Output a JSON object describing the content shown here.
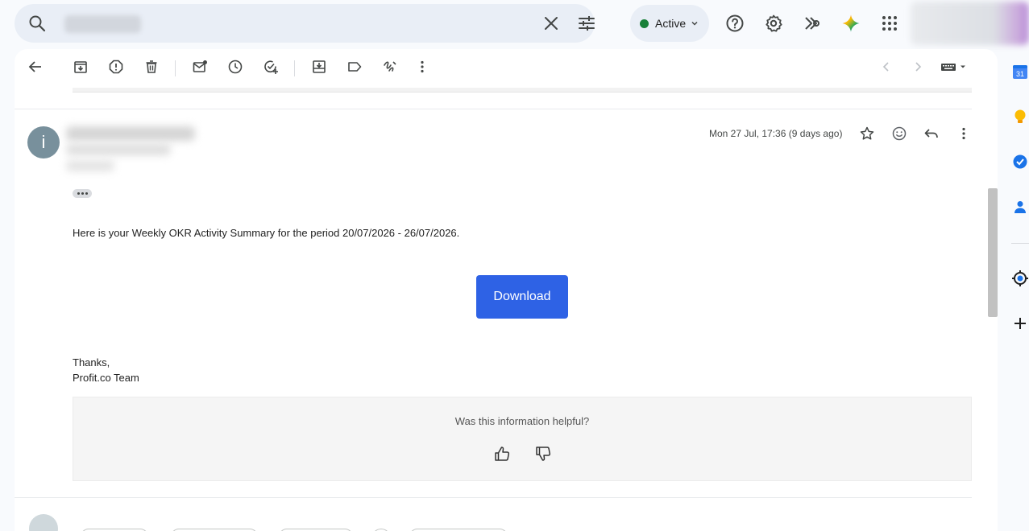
{
  "search": {
    "query_redacted": true,
    "clear_icon": "close-icon",
    "filter_icon": "tune-icon"
  },
  "header": {
    "status_label": "Active",
    "status_color": "#188038",
    "icons": [
      "help-icon",
      "settings-icon",
      "google-apps-script-icon",
      "gemini-icon",
      "apps-grid-icon"
    ]
  },
  "toolbar": {
    "icons": [
      "back-arrow-icon",
      "archive-icon",
      "report-spam-icon",
      "delete-icon",
      "mark-unread-icon",
      "snooze-icon",
      "add-task-icon",
      "move-to-icon",
      "label-icon",
      "filter-icon",
      "more-vert-icon"
    ],
    "nav_icons": [
      "chevron-left-icon",
      "chevron-right-icon",
      "keyboard-icon"
    ]
  },
  "message": {
    "avatar_letter": "i",
    "date": "Mon 27 Jul, 17:36 (9 days ago)",
    "body": "Here is your Weekly OKR Activity Summary for the period 20/07/2026 - 26/07/2026.",
    "download_label": "Download",
    "signoff_line1": "Thanks,",
    "signoff_line2": "Profit.co Team",
    "feedback_question": "Was this information helpful?"
  },
  "colors": {
    "accent": "#2e62e5",
    "avatar": "#78909c"
  }
}
